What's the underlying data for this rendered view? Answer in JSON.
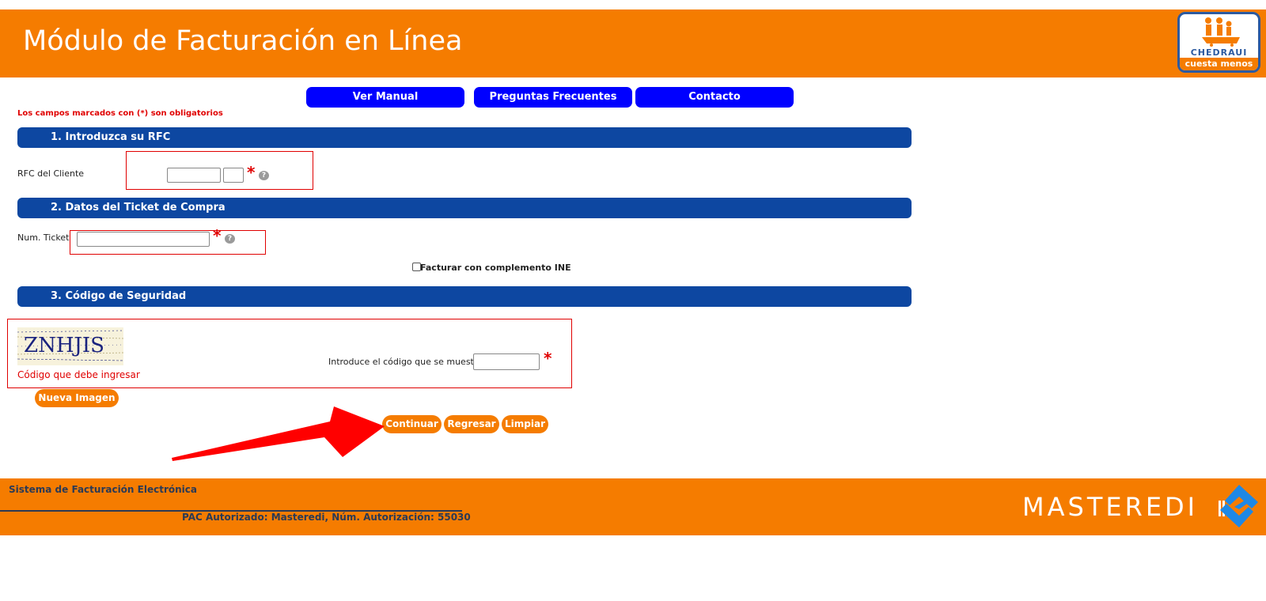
{
  "header": {
    "title": "Módulo de Facturación en Línea",
    "logo_brand": "CHEDRAUI",
    "logo_slogan": "cuesta menos"
  },
  "nav": {
    "manual": "Ver Manual",
    "faq": "Preguntas Frecuentes",
    "contact": "Contacto"
  },
  "required_note": "Los campos marcados con (*) son obligatorios",
  "section1": {
    "title": "1. Introduzca su RFC",
    "rfc_label": "RFC del Cliente",
    "rfc_value": "",
    "rfc_homoclave_value": ""
  },
  "section2": {
    "title": "2. Datos del Ticket de Compra",
    "ticket_label": "Num. Ticket",
    "ticket_value": "",
    "ine_checkbox_label": "Facturar con complemento INE",
    "ine_checked": false
  },
  "section3": {
    "title": "3. Código de Seguridad",
    "captcha_text": "ZNHJIS",
    "captcha_caption": "Código que debe ingresar",
    "code_label": "Introduce el código que se muestra",
    "code_value": "",
    "new_image_button": "Nueva Imagen"
  },
  "asterisk": "*",
  "help_glyph": "?",
  "actions": {
    "continue": "Continuar",
    "back": "Regresar",
    "clear": "Limpiar"
  },
  "footer": {
    "title": "Sistema de Facturación Electrónica",
    "pac": "PAC Autorizado: Masteredi, Núm. Autorización: 55030",
    "brand": "MASTEREDI"
  },
  "colors": {
    "orange": "#f57c00",
    "nav_blue": "#0000ff",
    "section_blue": "#0d47a1",
    "required_red": "#e00000"
  }
}
